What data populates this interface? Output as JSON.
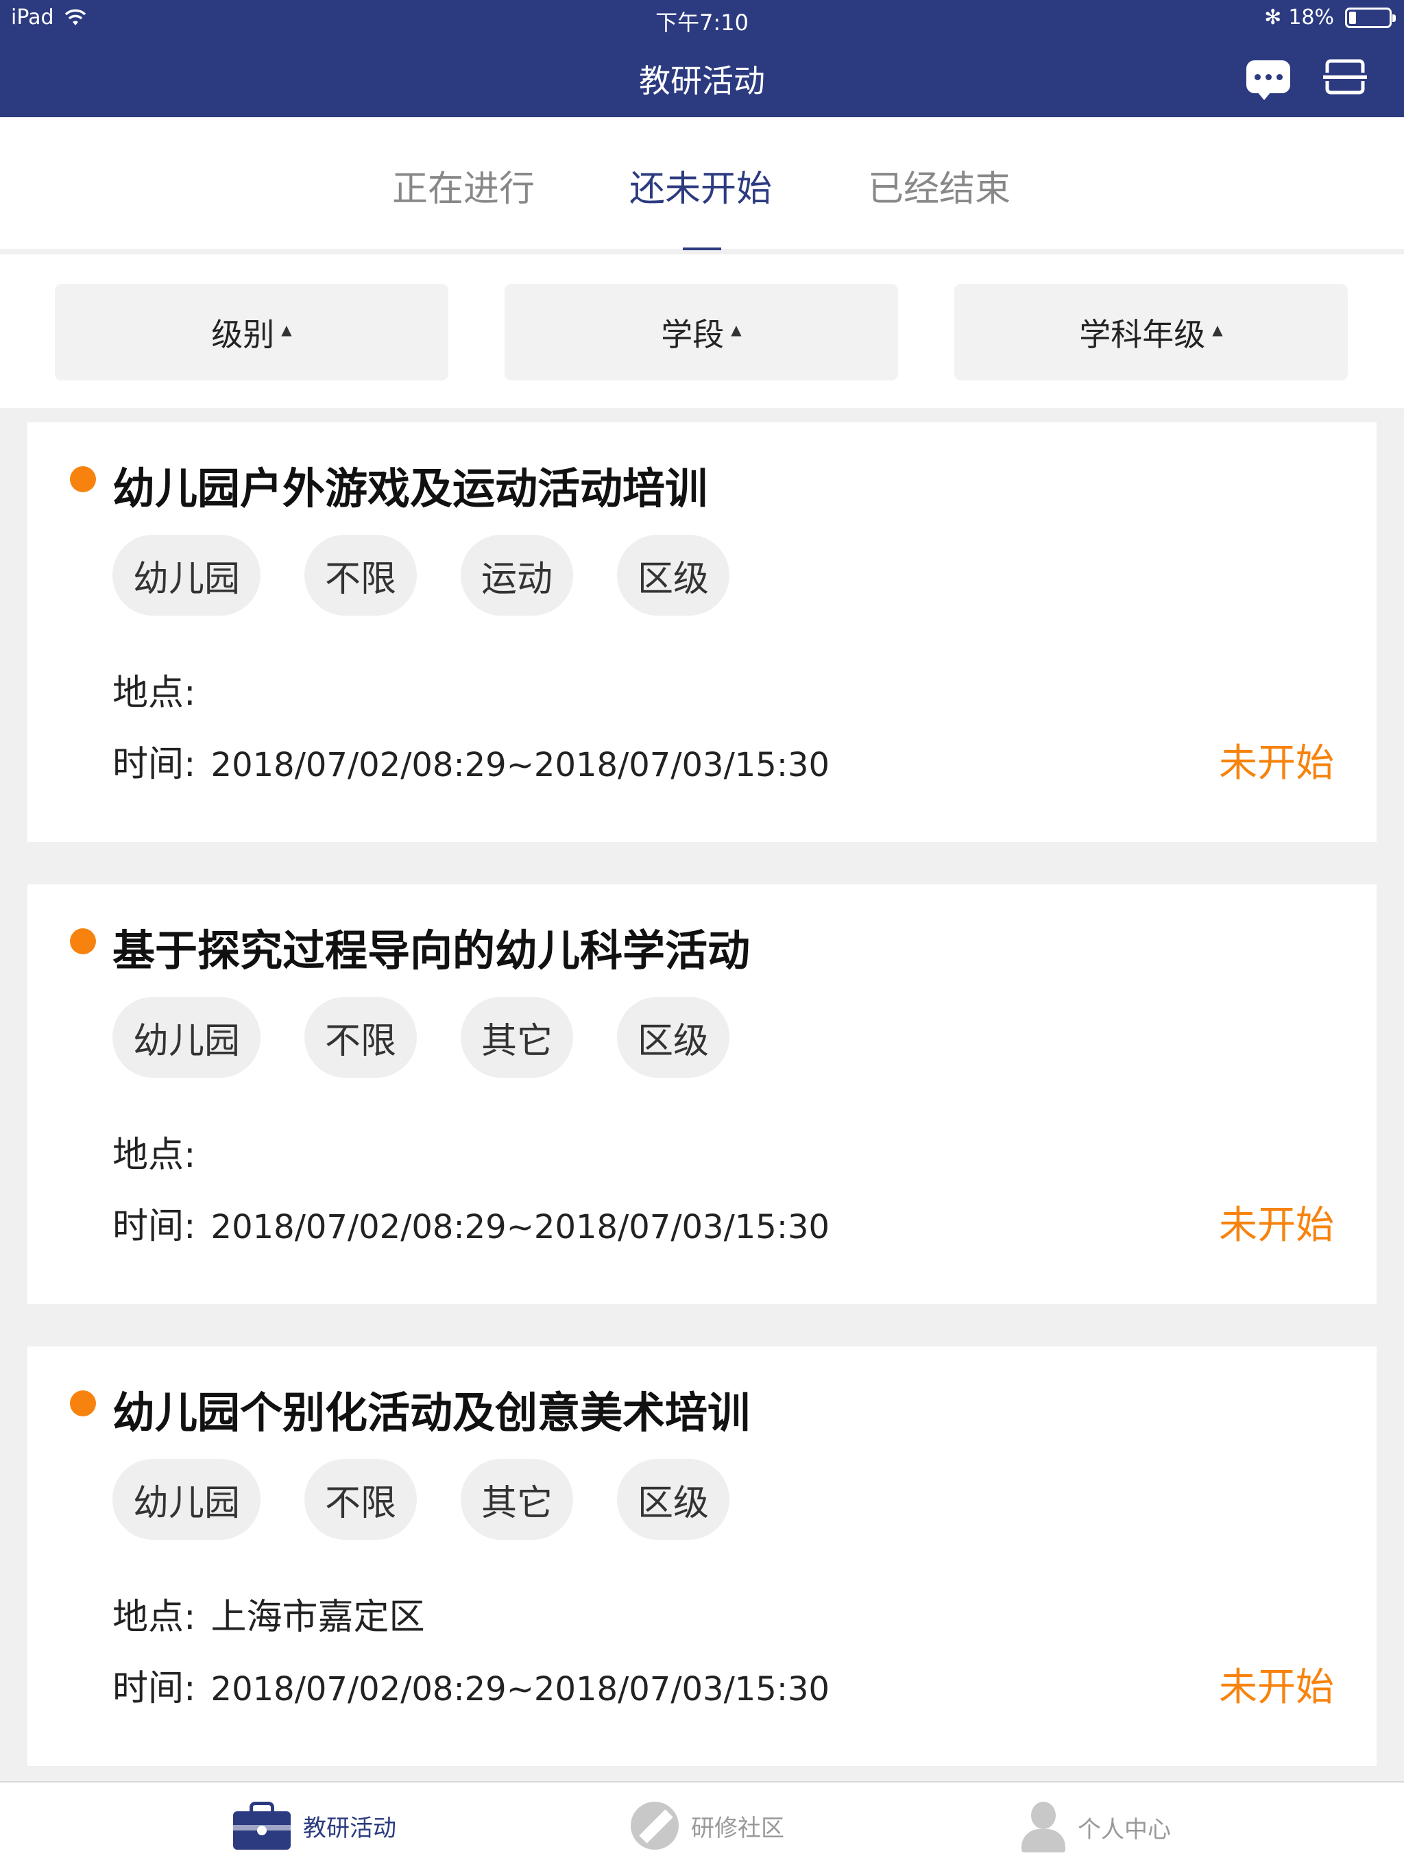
{
  "status_bar": {
    "device": "iPad",
    "time": "下午7:10",
    "bluetooth": "✻",
    "battery_text": "18%",
    "battery_level": 0.18
  },
  "nav": {
    "title": "教研活动",
    "chat_icon": "chat-bubble-icon",
    "scan_icon": "scan-icon"
  },
  "tabs": [
    {
      "label": "正在进行",
      "active": false
    },
    {
      "label": "还未开始",
      "active": true
    },
    {
      "label": "已经结束",
      "active": false
    }
  ],
  "filters": [
    {
      "label": "级别",
      "caret": "▲"
    },
    {
      "label": "学段",
      "caret": "▲"
    },
    {
      "label": "学科年级",
      "caret": "▲"
    }
  ],
  "labels": {
    "place": "地点:",
    "time": "时间:"
  },
  "activities": [
    {
      "title": "幼儿园户外游戏及运动活动培训",
      "tags": [
        "幼儿园",
        "不限",
        "运动",
        "区级"
      ],
      "place": "",
      "time": "2018/07/02/08:29~2018/07/03/15:30",
      "status": "未开始"
    },
    {
      "title": "基于探究过程导向的幼儿科学活动",
      "tags": [
        "幼儿园",
        "不限",
        "其它",
        "区级"
      ],
      "place": "",
      "time": "2018/07/02/08:29~2018/07/03/15:30",
      "status": "未开始"
    },
    {
      "title": "幼儿园个别化活动及创意美术培训",
      "tags": [
        "幼儿园",
        "不限",
        "其它",
        "区级"
      ],
      "place": "上海市嘉定区",
      "time": "2018/07/02/08:29~2018/07/03/15:30",
      "status": "未开始"
    }
  ],
  "tabbar": [
    {
      "label": "教研活动",
      "icon": "briefcase-icon",
      "active": true
    },
    {
      "label": "研修社区",
      "icon": "pencil-icon",
      "active": false
    },
    {
      "label": "个人中心",
      "icon": "person-icon",
      "active": false
    }
  ],
  "colors": {
    "header": "#2c3b80",
    "accent_orange": "#f7830e",
    "background": "#f0f0f0"
  }
}
